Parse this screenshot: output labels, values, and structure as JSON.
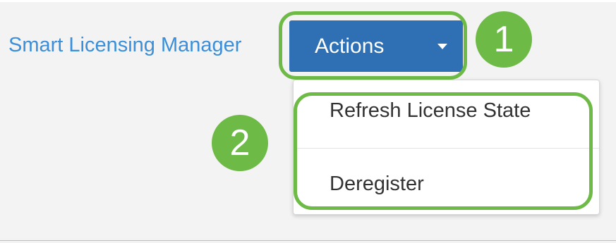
{
  "header": {
    "title": "Smart Licensing Manager"
  },
  "actions": {
    "label": "Actions",
    "icon": "chevron-down-icon",
    "button_color": "#2f6fb3"
  },
  "menu": {
    "items": [
      {
        "label": "Refresh License State"
      },
      {
        "label": "Deregister"
      }
    ]
  },
  "annotations": {
    "step1": "1",
    "step2": "2",
    "highlight_color": "#6dbb46"
  },
  "theme": {
    "link_color": "#3b8fd9",
    "background": "#f3f3f3"
  }
}
